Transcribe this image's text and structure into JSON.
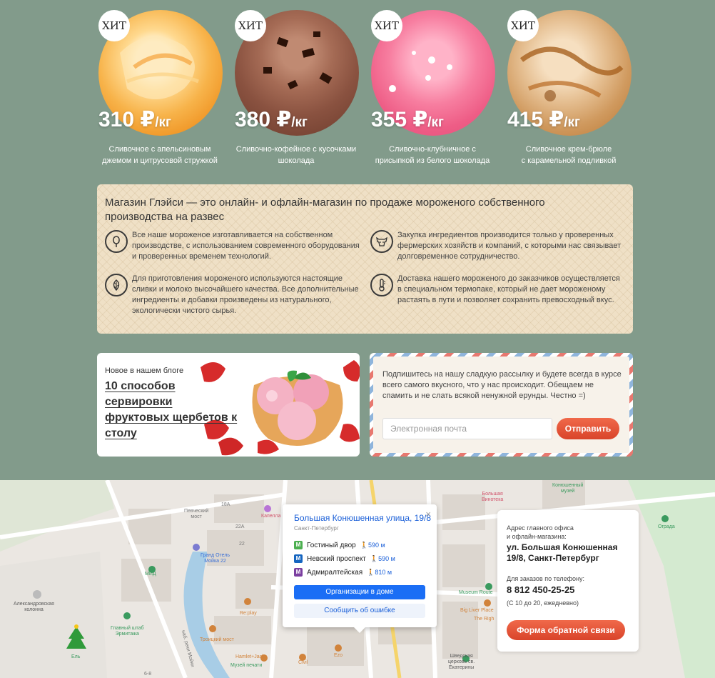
{
  "products": [
    {
      "badge": "ХИТ",
      "price_value": "310 ₽",
      "price_unit": "/кг",
      "desc_line1": "Сливочное с апельсиновым",
      "desc_line2": "джемом и цитрусовой стружкой"
    },
    {
      "badge": "ХИТ",
      "price_value": "380 ₽",
      "price_unit": "/кг",
      "desc_line1": "Сливочно-кофейное с кусочками",
      "desc_line2": "шоколада"
    },
    {
      "badge": "ХИТ",
      "price_value": "355 ₽",
      "price_unit": "/кг",
      "desc_line1": "Сливочно-клубничное с",
      "desc_line2": "присыпкой из белого шоколада"
    },
    {
      "badge": "ХИТ",
      "price_value": "415 ₽",
      "price_unit": "/кг",
      "desc_line1": "Сливочное крем-брюле",
      "desc_line2": "с карамельной подливкой"
    }
  ],
  "about": {
    "title": "Магазин Глэйси — это онлайн- и офлайн-магазин по продаже мороженого собственного производства на развес",
    "features": [
      {
        "icon": "ice-cream-icon",
        "text": "Все наше мороженое изготавливается на собственном производстве, с использованием современного оборудования и проверенных временем технологий."
      },
      {
        "icon": "cow-icon",
        "text": "Закупка ингредиентов производится только у проверенных фермерских хозяйств и компаний, с которыми нас связывает долговременное сотрудничество."
      },
      {
        "icon": "leaf-icon",
        "text": "Для приготовления мороженого используются настоящие сливки и молоко высочайшего качества. Все дополнительные ингредиенты и добавки произведены из натурального, экологически чистого сырья."
      },
      {
        "icon": "thermometer-icon",
        "text": "Доставка нашего мороженого до заказчиков осуществляется в специальном термопаке, который не дает мороженому растаять в пути и позволяет сохранить превосходный вкус."
      }
    ]
  },
  "blog": {
    "kicker": "Новое в нашем блоге",
    "title_line1": "10 способов сервировки",
    "title_line2": "фруктовых щербетов к",
    "title_line3": "столу"
  },
  "newsletter": {
    "text": "Подпишитесь на нашу сладкую рассылку и будете всегда в курсе всего самого вкусного, что у нас происходит. Обещаем не спамить и не слать всякой ненужной ерунды. Честно =)",
    "placeholder": "Электронная почта",
    "button": "Отправить"
  },
  "map": {
    "labels": {
      "pevchesky": "Певческий\nмост",
      "alexandr": "Александровская\nколонна",
      "grand_hotel": "Гранд Отель\nМойка 22",
      "mid": "МИД",
      "kapella": "Капелла",
      "replay": "Re:play",
      "troitsky": "Троицкий мост",
      "glavny": "Главный штаб\nЭрмитажа",
      "hamlet": "Hamlet+Jacks",
      "muzey_pechati": "Музей печати",
      "civil": "Civil",
      "ezo": "Ezo",
      "el": "Ель",
      "bolshaya_vinoteka": "Большая\nВинотека",
      "konyushenny_muzey": "Конюшенный\nмузей",
      "museum_route": "Museum Route",
      "big_liver": "Big Liver Place",
      "the_right": "The Righ",
      "shvedskaya": "Шведская\nцерковь св.\nЕкатерины",
      "ograda": "Ограда",
      "street_moyki": "наб. реки Мойки",
      "n18a": "18А",
      "n22a": "22А",
      "n22": "22",
      "n6_8": "6-8"
    },
    "popup": {
      "title": "Большая Конюшенная улица, 19/8",
      "city": "Санкт-Петербург",
      "close": "×",
      "metro": [
        {
          "letter": "М",
          "color": "#4caf50",
          "name": "Гостиный двор",
          "dist": "590 м"
        },
        {
          "letter": "М",
          "color": "#1565c0",
          "name": "Невский проспект",
          "dist": "590 м"
        },
        {
          "letter": "М",
          "color": "#7b3fa0",
          "name": "Адмиралтейская",
          "dist": "810 м"
        }
      ],
      "btn_orgs": "Организации в доме",
      "btn_error": "Сообщить об ошибке"
    }
  },
  "contact": {
    "caption_line1": "Адрес главного офиса",
    "caption_line2": "и офлайн-магазина:",
    "address": "ул. Большая Конюшенная 19/8, Санкт-Петербург",
    "phone_caption": "Для заказов по телефону:",
    "phone": "8 812 450-25-25",
    "hours": "(С 10 до 20, ежедневно)",
    "button": "Форма обратной связи"
  }
}
